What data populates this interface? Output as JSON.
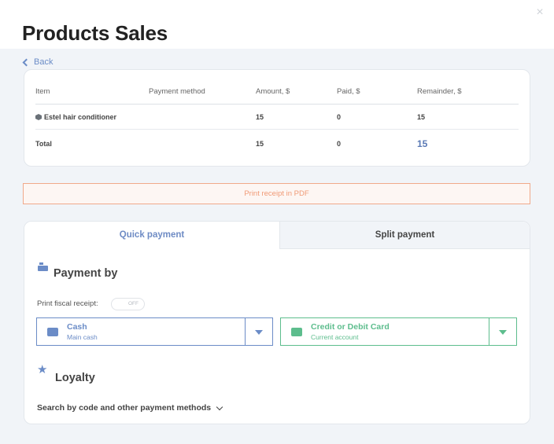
{
  "dialog": {
    "title": "Products Sales",
    "close_icon": "×",
    "back_label": "Back"
  },
  "table": {
    "headers": [
      "Item",
      "Payment method",
      "Amount, $",
      "Paid, $",
      "Remainder, $"
    ],
    "rows": [
      {
        "item": "Estel hair conditioner",
        "payment_method": "",
        "amount": "15",
        "paid": "0",
        "remainder": "15"
      }
    ],
    "total": {
      "label": "Total",
      "amount": "15",
      "paid": "0",
      "remainder": "15"
    }
  },
  "print_pdf_label": "Print receipt in PDF",
  "tabs": [
    {
      "label": "Quick payment",
      "active": true
    },
    {
      "label": "Split payment",
      "active": false
    }
  ],
  "payment": {
    "title": "Payment by",
    "fiscal_label": "Print fiscal receipt:",
    "fiscal_toggle": "OFF",
    "methods": [
      {
        "name": "Cash",
        "account": "Main cash",
        "icon": "wallet-icon",
        "color": "#6b8cc7"
      },
      {
        "name": "Credit or Debit Card",
        "account": "Current account",
        "icon": "card-icon",
        "color": "#5dbd8d"
      }
    ]
  },
  "loyalty": {
    "title": "Loyalty",
    "icon": "star-icon"
  },
  "search_link": "Search by code and other payment methods",
  "colors": {
    "accent": "#6b8cc7",
    "card_green": "#5dbd8d",
    "pdf_orange": "#f09a76"
  }
}
